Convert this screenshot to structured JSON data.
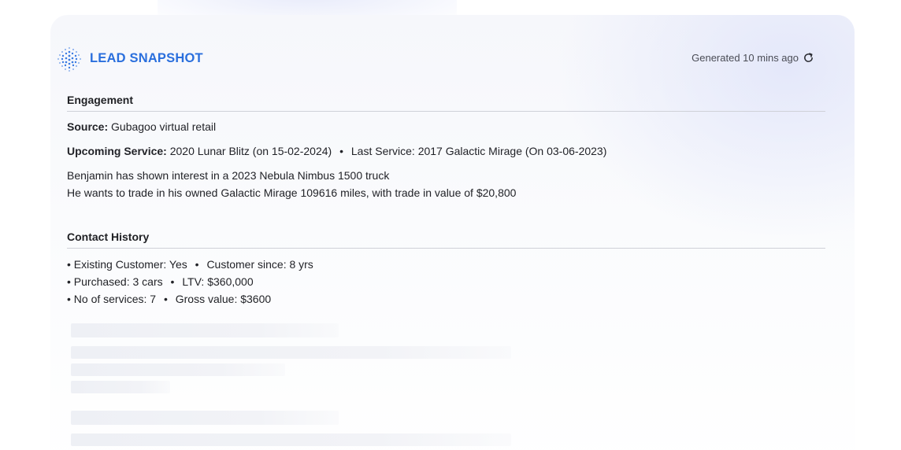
{
  "header": {
    "brand": "LEAD SNAPSHOT",
    "generated": "Generated 10 mins ago",
    "logo_icon": "dot-globe-logo-icon",
    "refresh_icon": "refresh-icon"
  },
  "engagement": {
    "title": "Engagement",
    "source_label": "Source:",
    "source_value": "Gubagoo virtual retail",
    "upcoming_label": "Upcoming Service:",
    "upcoming_value": "2020 Lunar Blitz (on 15-02-2024)",
    "separator": "•",
    "last_service": "Last Service: 2017 Galactic Mirage (On 03-06-2023)",
    "summary_line1": "Benjamin has shown interest in a 2023 Nebula Nimbus 1500 truck",
    "summary_line2": "He wants to trade in his owned Galactic Mirage 109616 miles, with trade in value of $20,800"
  },
  "contact_history": {
    "title": "Contact History",
    "rows": [
      {
        "left": "• Existing Customer: Yes",
        "right": "Customer since: 8 yrs"
      },
      {
        "left": "• Purchased: 3 cars",
        "right": "LTV: $360,000"
      },
      {
        "left": "• No of services: 7",
        "right": "Gross value: $3600"
      }
    ]
  },
  "colors": {
    "brand": "#2a6fdd",
    "text": "#1f2024",
    "muted": "#4a4c55",
    "rule": "#cfd1d8",
    "skeleton": "#eef0f5"
  }
}
